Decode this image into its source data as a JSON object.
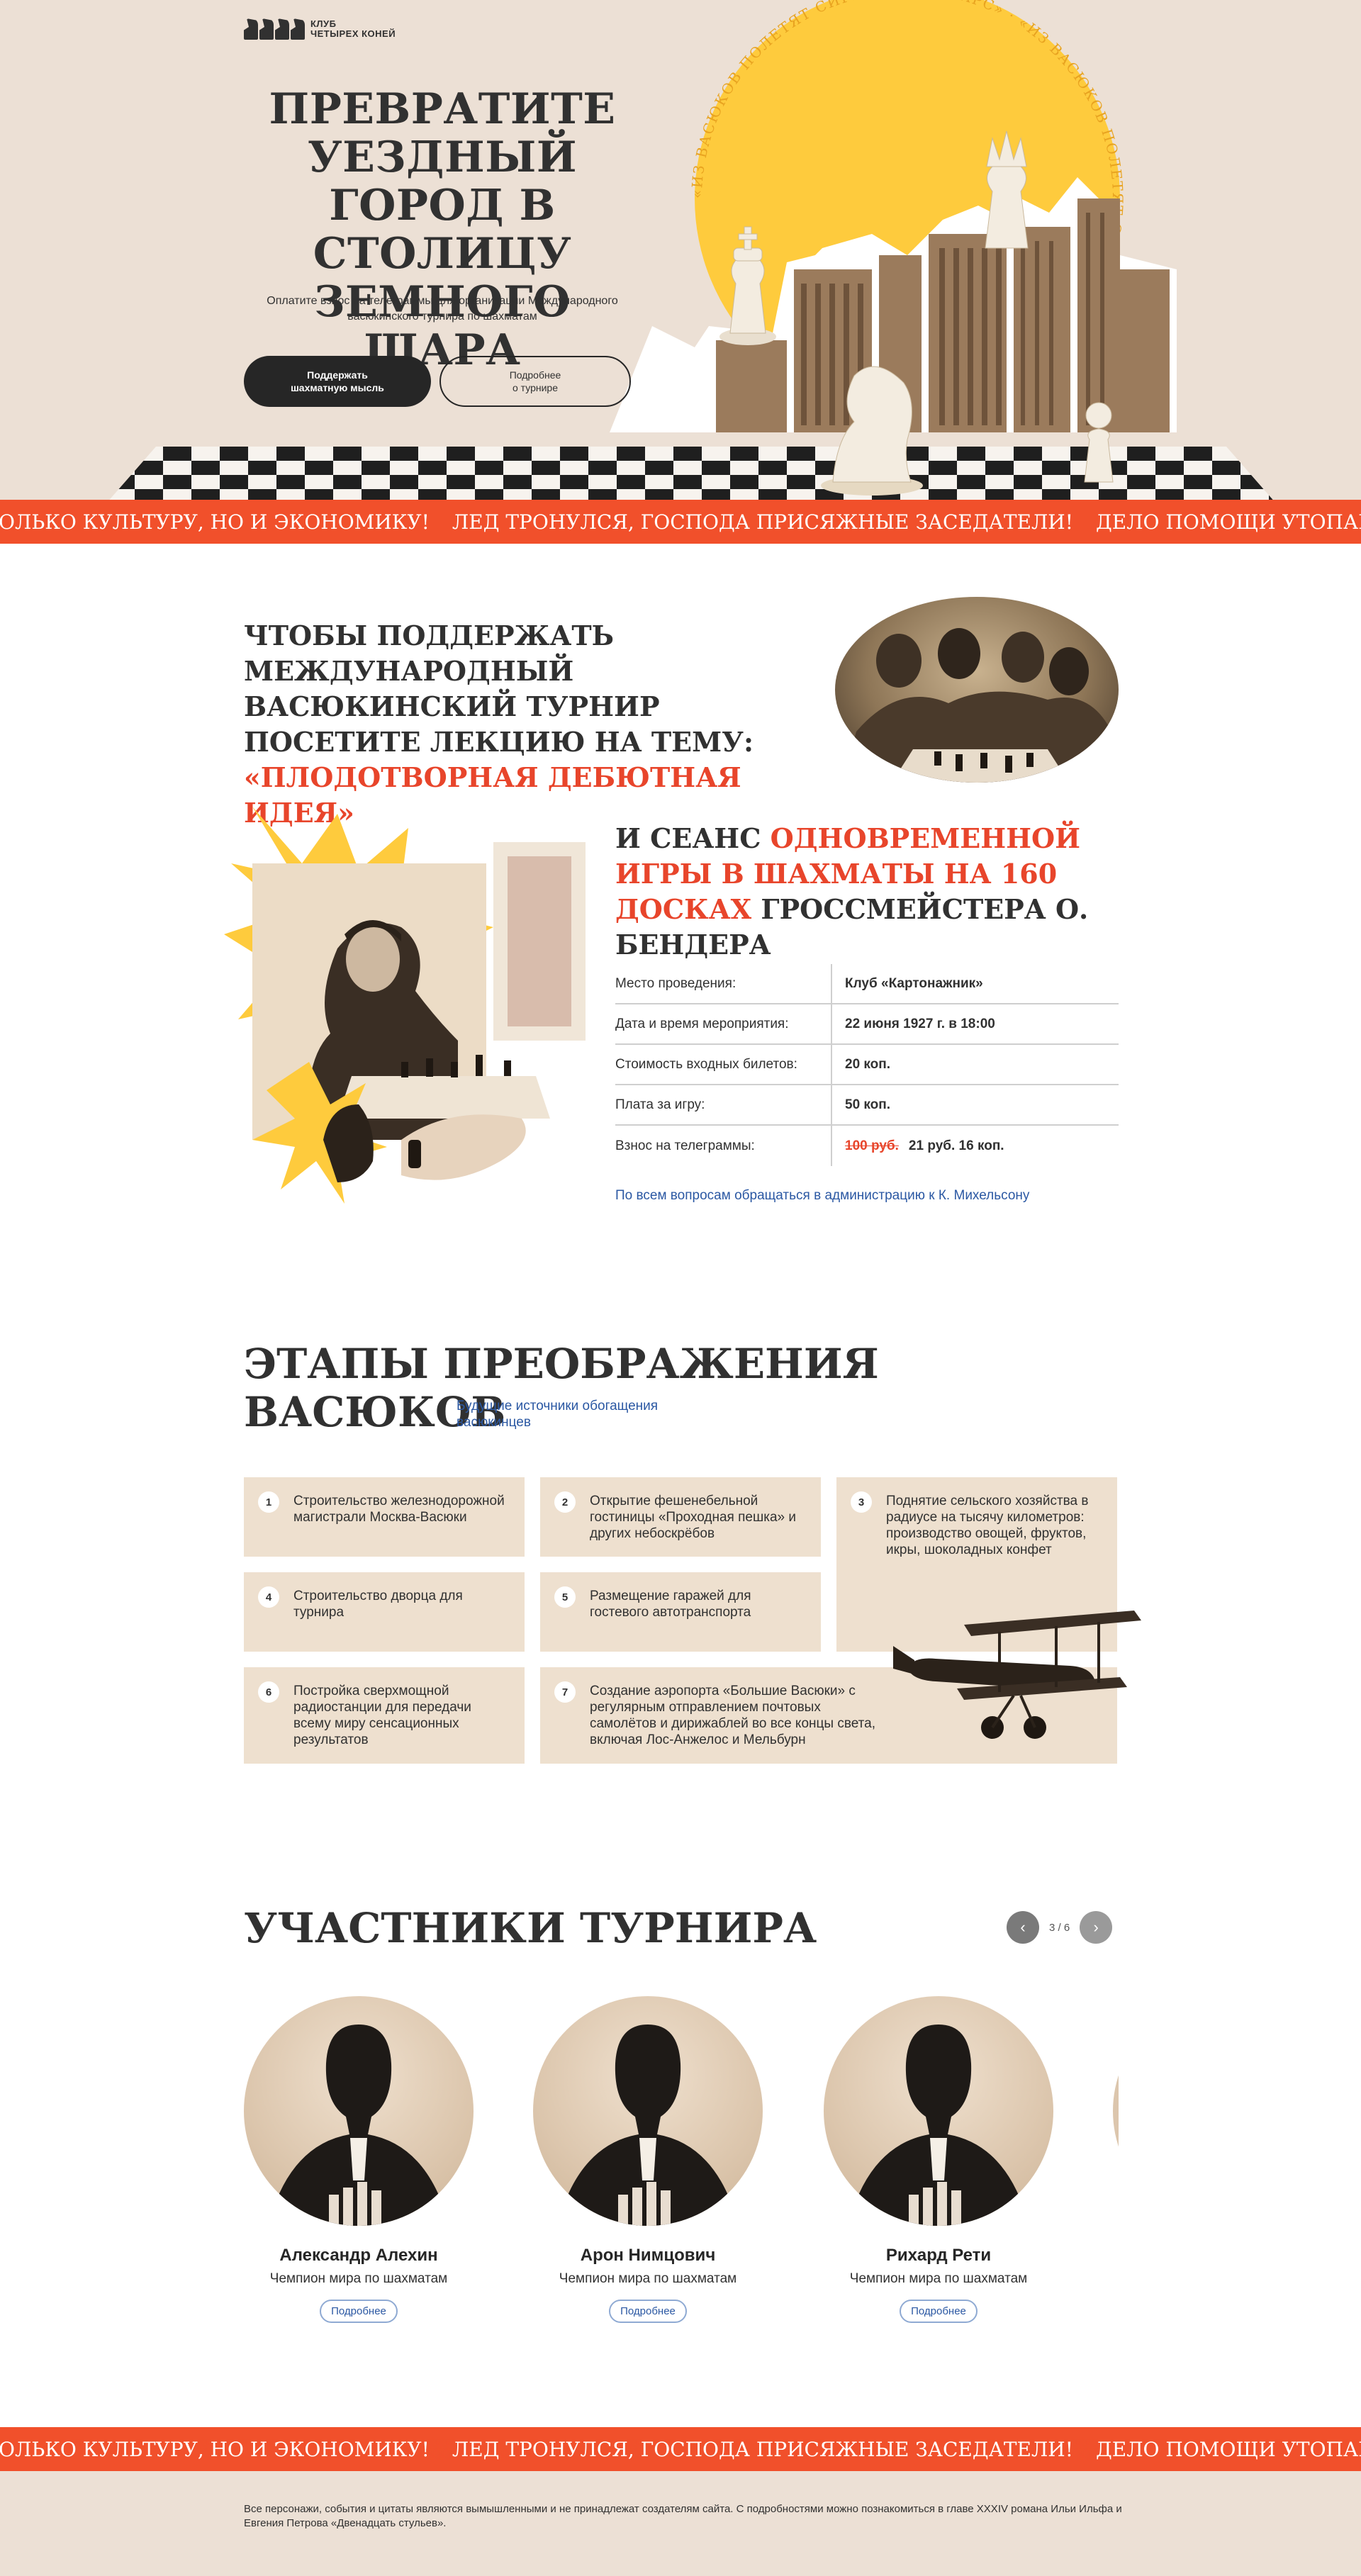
{
  "logo": {
    "line1": "КЛУБ",
    "line2": "ЧЕТЫРЕХ КОНЕЙ",
    "icon": "four-horses-icon"
  },
  "hero": {
    "title": "ПРЕВРАТИТЕ УЕЗДНЫЙ ГОРОД В СТОЛИЦУ ЗЕМНОГО ШАРА",
    "subtitle": "Оплатите взнос на телеграммы для организации Международного васюкинского турнира по шахматам",
    "btn_primary": "Поддержать\nшахматную мысль",
    "btn_secondary": "Подробнее\nо турнире",
    "badge_text": "«ИЗ ВАСЮКОВ ПОЛЕТЯТ СИГНАЛЫ НА МАРС» · «ИЗ ВАСЮКОВ ПОЛЕТЯТ СИГНАЛЫ НА МАРС» · "
  },
  "ticker": {
    "items": [
      "ОЛЬКО КУЛЬТУРУ, НО И ЭКОНОМИКУ!",
      "ЛЕД ТРОНУЛСЯ, ГОСПОДА ПРИСЯЖНЫЕ ЗАСЕДАТЕЛИ!",
      "ДЕЛО ПОМОЩИ УТОПАЮЩИМ — ДЕЛО РУК САМИХ УТОПАЮЩИХ!"
    ]
  },
  "lecture": {
    "title_plain": "ЧТОБЫ ПОДДЕРЖАТЬ МЕЖДУНАРОДНЫЙ ВАСЮКИНСКИЙ ТУРНИР ПОСЕТИТЕ ЛЕКЦИЮ НА ТЕМУ:",
    "title_highlight": "«ПЛОДОТВОРНАЯ ДЕБЮТНАЯ ИДЕЯ»"
  },
  "session": {
    "title_start": "И СЕАНС ",
    "title_highlight": "ОДНОВРЕМЕННОЙ ИГРЫ В ШАХМАТЫ НА 160 ДОСКАХ",
    "title_end": " ГРОССМЕЙСТЕРА О. БЕНДЕРА"
  },
  "info": {
    "rows": [
      {
        "label": "Место проведения:",
        "value": "Клуб «Картонажник»"
      },
      {
        "label": "Дата и время мероприятия:",
        "value": "22 июня 1927 г. в 18:00"
      },
      {
        "label": "Стоимость входных билетов:",
        "value": "20 коп."
      },
      {
        "label": "Плата за игру:",
        "value": "50 коп."
      }
    ],
    "fee_label": "Взнос на телеграммы:",
    "fee_old": "100 руб.",
    "fee_new": "21 руб. 16 коп.",
    "contact": "По всем вопросам обращаться в администрацию к К. Михельсону"
  },
  "stages": {
    "title_line1": "ЭТАПЫ ПРЕОБРАЖЕНИЯ",
    "title_line2": "ВАСЮКОВ",
    "subtitle": "Будущие источники обогащения васюкинцев",
    "items": [
      {
        "num": "1",
        "text": "Строительство железнодорожной магистрали Москва-Васюки"
      },
      {
        "num": "2",
        "text": "Открытие фешенебельной гостиницы «Проходная пешка» и других небоскрёбов"
      },
      {
        "num": "3",
        "text": "Поднятие сельского хозяйства в радиусе на тысячу километров: производство овощей, фруктов, икры, шоколадных конфет"
      },
      {
        "num": "4",
        "text": "Строительство дворца для турнира"
      },
      {
        "num": "5",
        "text": "Размещение гаражей для гостевого автотранспорта"
      },
      {
        "num": "6",
        "text": "Постройка сверхмощной радиостанции для передачи всему миру сенсационных результатов"
      },
      {
        "num": "7",
        "text": "Создание аэропорта «Большие Васюки» с регулярным отправлением почтовых самолётов и дирижаблей во все концы света, включая Лос-Анжелос и Мельбурн"
      }
    ]
  },
  "participants": {
    "title": "УЧАСТНИКИ ТУРНИРА",
    "pager": "3 / 6",
    "more_label": "Подробнее",
    "items": [
      {
        "name": "Александр Алехин",
        "role": "Чемпион мира по шахматам"
      },
      {
        "name": "Арон Нимцович",
        "role": "Чемпион мира по шахматам"
      },
      {
        "name": "Рихард Рети",
        "role": "Чемпион мира по шахматам"
      }
    ]
  },
  "footer": {
    "text": "Все персонажи, события и цитаты являются вымышленными и не принадлежат создателям сайта. С подробностями можно познакомиться в главе XXXIV романа Ильи Ильфа и Евгения Петрова «Двенадцать стульев»."
  },
  "colors": {
    "accent": "#f1502b",
    "link": "#2b58a3",
    "beige": "#ece0d5",
    "card": "#eee0cf",
    "yellow": "#fecb3d"
  }
}
